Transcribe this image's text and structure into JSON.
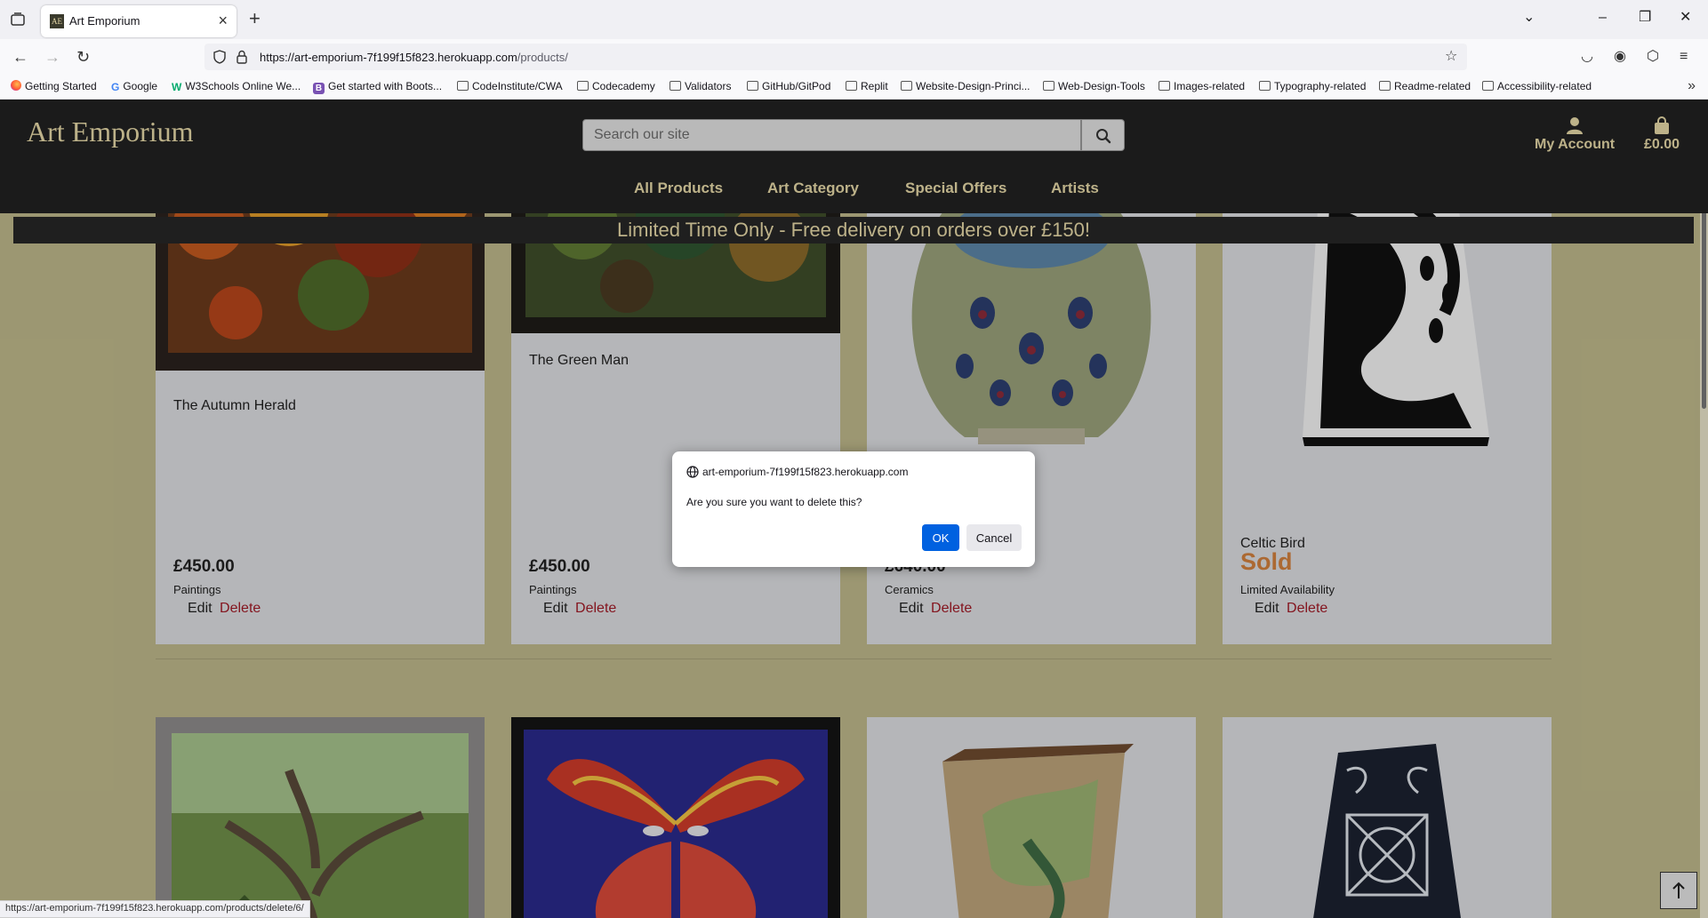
{
  "browser": {
    "tab_title": "Art Emporium",
    "tab_favicon": "AE",
    "url_host": "https://art-emporium-7f199f15f823.herokuapp.com",
    "url_path": "/products/",
    "status_url": "https://art-emporium-7f199f15f823.herokuapp.com/products/delete/6/",
    "bookmarks": [
      "Getting Started",
      "Google",
      "W3Schools Online We...",
      "Get started with Boots...",
      "CodeInstitute/CWA",
      "Codecademy",
      "Validators",
      "GitHub/GitPod",
      "Replit",
      "Website-Design-Princi...",
      "Web-Design-Tools",
      "Images-related",
      "Typography-related",
      "Readme-related",
      "Accessibility-related"
    ]
  },
  "site": {
    "logo": "Art Emporium",
    "search_placeholder": "Search our site",
    "account_label": "My Account",
    "basket_total": "£0.00",
    "nav": [
      "All Products",
      "Art Category",
      "Special Offers",
      "Artists"
    ],
    "banner": "Limited Time Only - Free delivery on orders over £150!"
  },
  "products": [
    {
      "title": "The Autumn Herald",
      "price": "£450.00",
      "category": "Paintings",
      "edit": "Edit",
      "delete": "Delete"
    },
    {
      "title": "The Green Man",
      "price": "£450.00",
      "category": "Paintings",
      "edit": "Edit",
      "delete": "Delete"
    },
    {
      "title": "",
      "price": "£640.00",
      "category": "Ceramics",
      "edit": "Edit",
      "delete": "Delete"
    },
    {
      "title": "Celtic Bird",
      "status": "Sold",
      "category": "Limited Availability",
      "edit": "Edit",
      "delete": "Delete"
    }
  ],
  "dialog": {
    "origin": "art-emporium-7f199f15f823.herokuapp.com",
    "message": "Are you sure you want to delete this?",
    "ok_label": "OK",
    "cancel_label": "Cancel"
  },
  "colors": {
    "header_bg": "#222222",
    "accent_gold": "#e7d9a8",
    "page_bg": "#bfb98b",
    "delete_red": "#a11a26",
    "sold_orange": "#d2803e"
  }
}
